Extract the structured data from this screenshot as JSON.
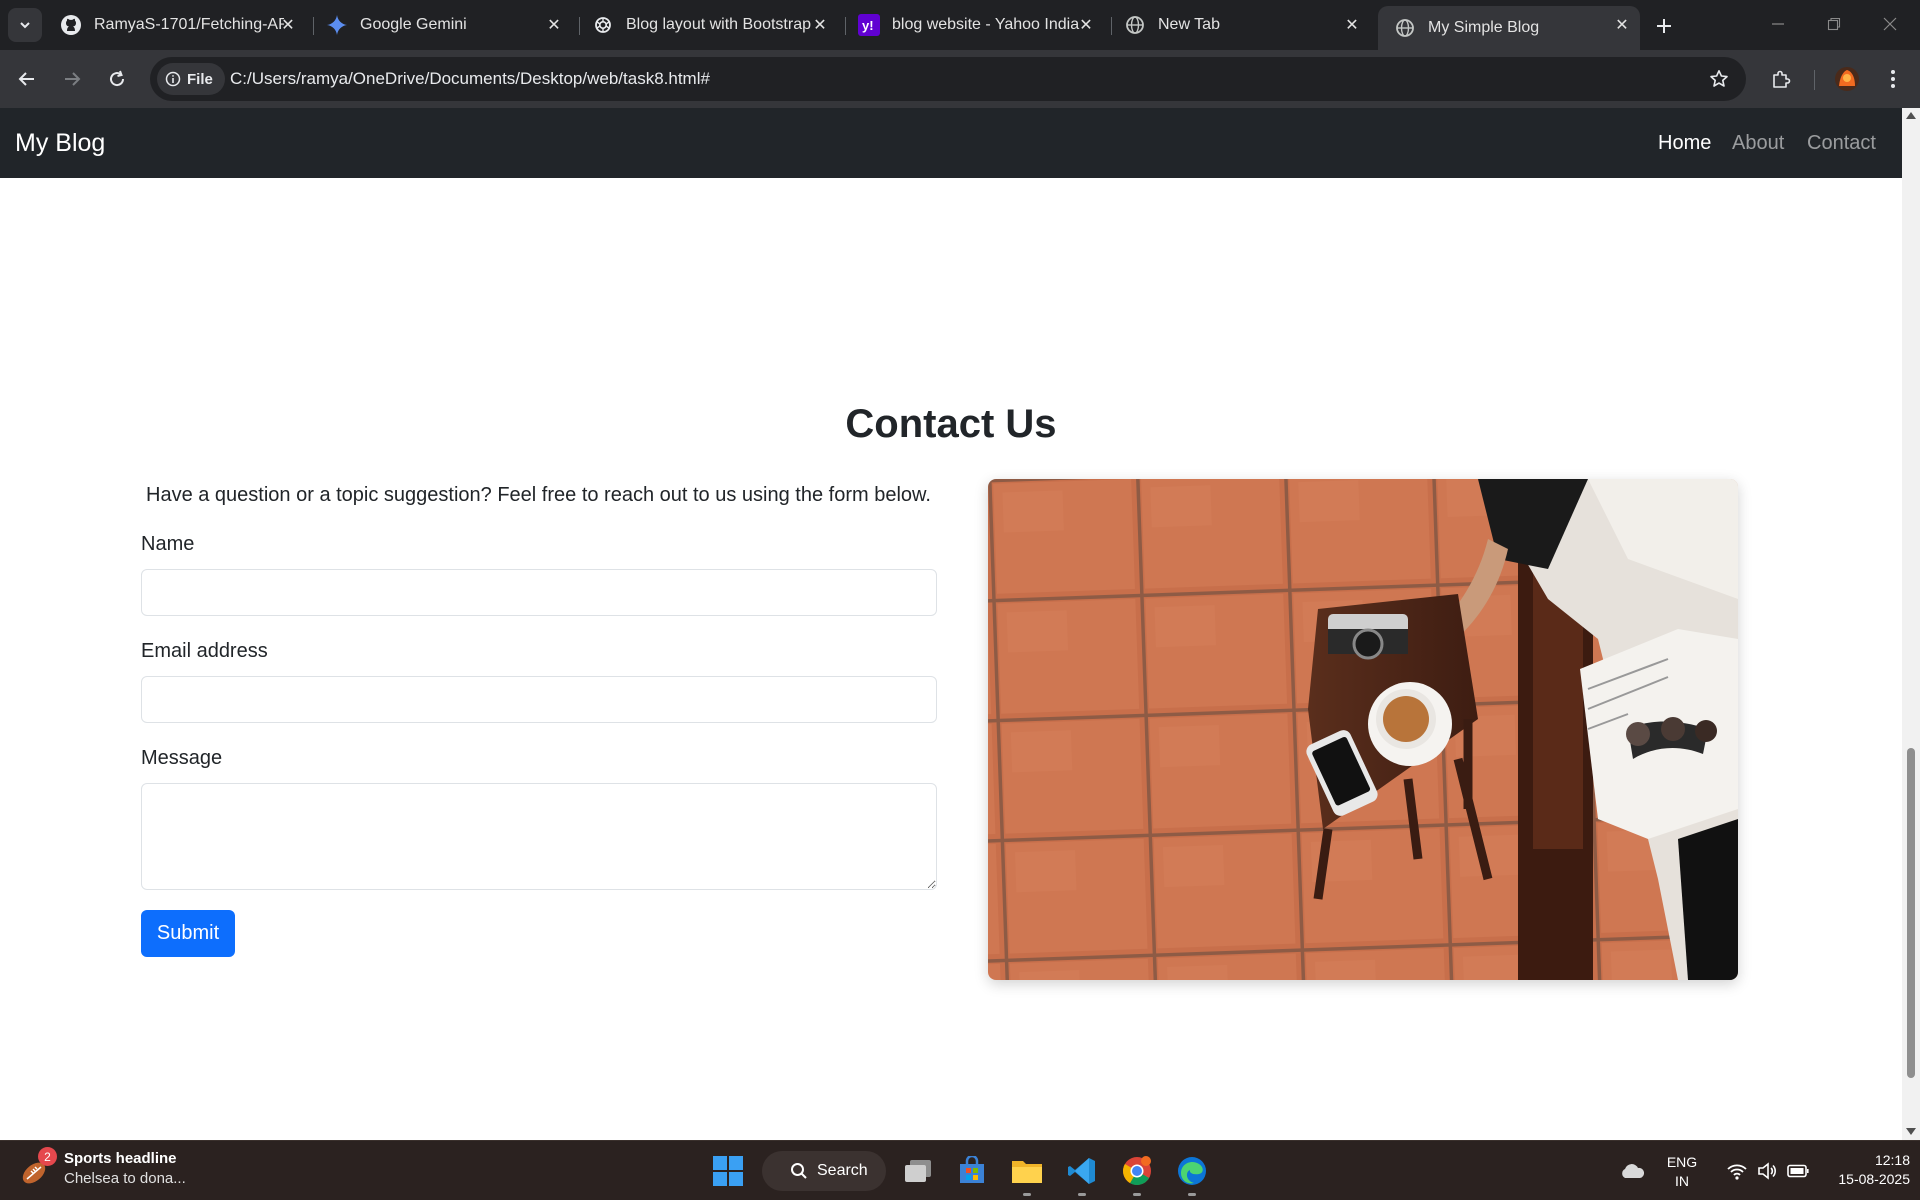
{
  "browser": {
    "tabs": [
      {
        "title": "RamyaS-1701/Fetching-AP",
        "icon": "github-icon"
      },
      {
        "title": "Google Gemini",
        "icon": "gemini-icon"
      },
      {
        "title": "Blog layout with Bootstrap",
        "icon": "openai-icon"
      },
      {
        "title": "blog website - Yahoo India",
        "icon": "yahoo-icon"
      },
      {
        "title": "New Tab",
        "icon": "globe-icon"
      },
      {
        "title": "My Simple Blog",
        "icon": "globe-icon",
        "active": true
      }
    ],
    "address": {
      "scheme_chip": "File",
      "url": "C:/Users/ramya/OneDrive/Documents/Desktop/web/task8.html#"
    }
  },
  "page": {
    "navbar": {
      "brand": "My Blog",
      "links": [
        "Home",
        "About",
        "Contact"
      ],
      "active_link": "Home"
    },
    "contact": {
      "title": "Contact Us",
      "lead": "Have a question or a topic suggestion? Feel free to reach out to us using the form below.",
      "name_label": "Name",
      "email_label": "Email address",
      "message_label": "Message",
      "name_value": "",
      "email_value": "",
      "message_value": "",
      "submit_label": "Submit",
      "image_subject": "Overhead photo of a person with a magazine, a cup of tea, a camera and a phone on a small wooden table over terracotta floor tiles"
    },
    "colors": {
      "navbar_bg": "#212529",
      "primary": "#0d6efd",
      "text": "#212529"
    }
  },
  "taskbar": {
    "widget": {
      "badge": "2",
      "title": "Sports headline",
      "subtitle": "Chelsea to dona..."
    },
    "search_label": "Search",
    "tray": {
      "lang_line1": "ENG",
      "lang_line2": "IN",
      "time": "12:18",
      "date": "15-08-2025"
    },
    "apps": [
      "start-icon",
      "task-view-icon",
      "store-icon",
      "file-explorer-icon",
      "vscode-icon",
      "chrome-icon",
      "edge-icon"
    ]
  }
}
